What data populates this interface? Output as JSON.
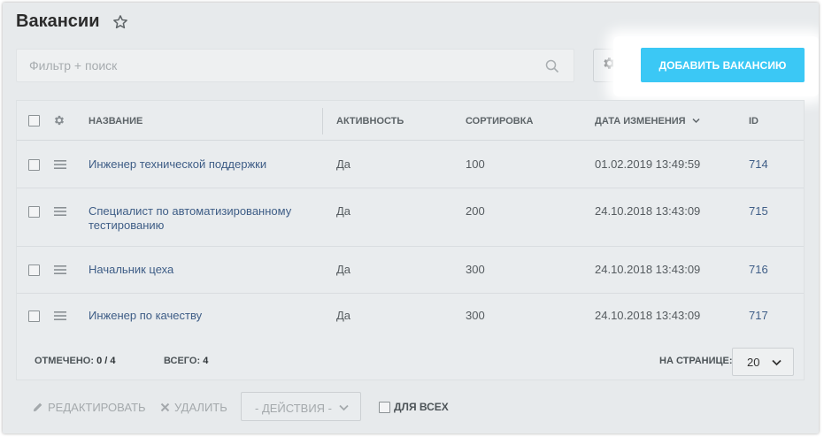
{
  "page": {
    "title": "Вакансии"
  },
  "toolbar": {
    "filter_placeholder": "Фильтр + поиск",
    "add_button_label": "Добавить вакансию",
    "accent_color": "#3bc8f5"
  },
  "grid": {
    "columns": {
      "name": "Название",
      "active": "Активность",
      "sort": "Сортировка",
      "date": "Дата изменения",
      "id": "ID"
    },
    "rows": [
      {
        "name": "Инженер технической поддержки",
        "active": "Да",
        "sort": "100",
        "date": "01.02.2019 13:49:59",
        "id": "714"
      },
      {
        "name": "Специалист по автоматизированному тестированию",
        "active": "Да",
        "sort": "200",
        "date": "24.10.2018 13:43:09",
        "id": "715"
      },
      {
        "name": "Начальник цеха",
        "active": "Да",
        "sort": "300",
        "date": "24.10.2018 13:43:09",
        "id": "716"
      },
      {
        "name": "Инженер по качеству",
        "active": "Да",
        "sort": "300",
        "date": "24.10.2018 13:43:09",
        "id": "717"
      }
    ]
  },
  "footer": {
    "marked_label": "Отмечено:",
    "marked_value": "0 / 4",
    "total_label": "Всего:",
    "total_value": "4",
    "per_page_label": "На странице:",
    "per_page_value": "20"
  },
  "actions": {
    "edit_label": "Редактировать",
    "delete_label": "Удалить",
    "actions_select": "- Действия -",
    "for_all_label": "Для всех"
  }
}
